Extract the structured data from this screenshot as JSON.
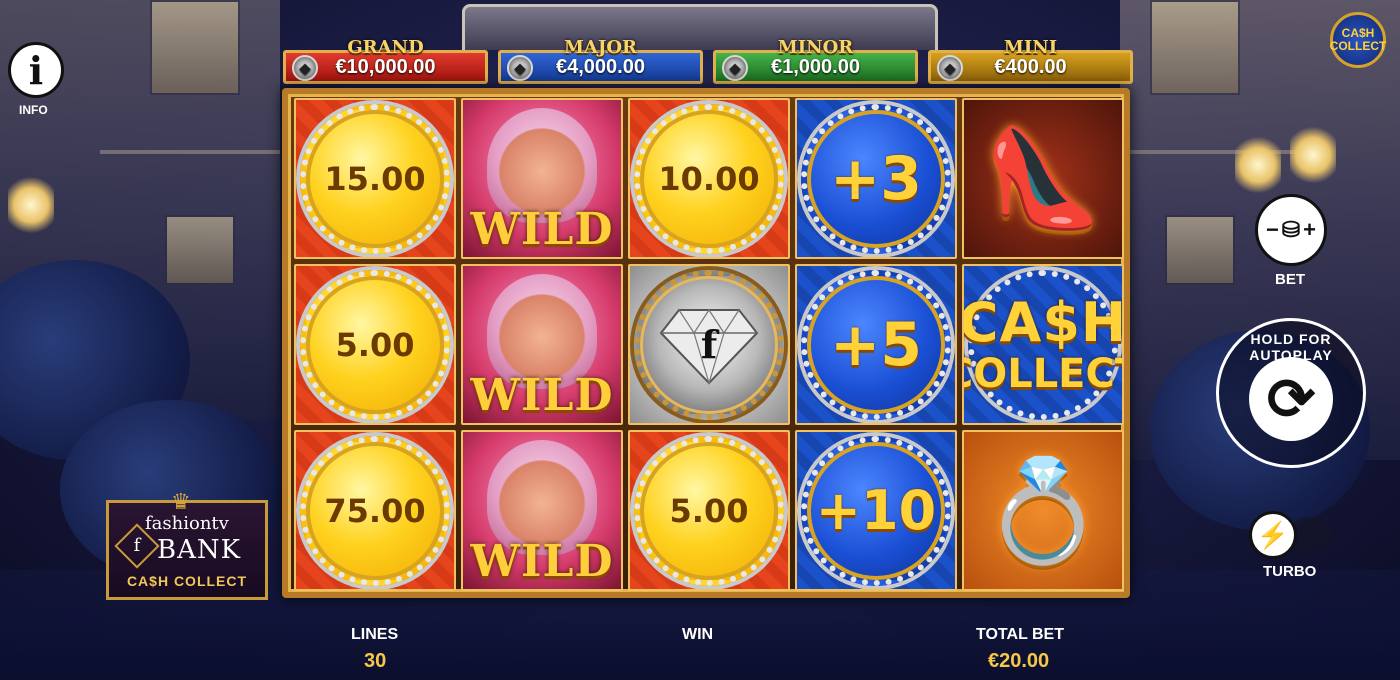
{
  "jackpots": {
    "grand": {
      "title": "GRAND",
      "amount": "€10,000.00"
    },
    "major": {
      "title": "MAJOR",
      "amount": "€4,000.00"
    },
    "minor": {
      "title": "MINOR",
      "amount": "€1,000.00"
    },
    "mini": {
      "title": "MINI",
      "amount": "€400.00"
    }
  },
  "reels": {
    "r1": {
      "c1": "15.00",
      "c2": "WILD",
      "c3": "10.00",
      "c4": "+3"
    },
    "r2": {
      "c1": "5.00",
      "c2": "WILD",
      "c3": "f",
      "c4": "+5",
      "c5a": "CA$H",
      "c5b": "COLLECT"
    },
    "r3": {
      "c1": "75.00",
      "c2": "WILD",
      "c3": "5.00",
      "c4": "+10"
    }
  },
  "left": {
    "info_label": "INFO",
    "logo": {
      "line1": "fashiontv",
      "mark": "f",
      "line2": "BANK",
      "line3": "CA$H COLLECT"
    }
  },
  "right": {
    "badge_line1": "CA$H",
    "badge_line2": "COLLECT",
    "bet_label": "BET",
    "autoplay_text": "HOLD FOR AUTOPLAY",
    "turbo_label": "TURBO"
  },
  "bottom": {
    "lines_label": "LINES",
    "lines_value": "30",
    "win_label": "WIN",
    "total_bet_label": "TOTAL BET",
    "total_bet_value": "€20.00"
  },
  "colors": {
    "grand": "#e23a2e",
    "major": "#2f66d8",
    "minor": "#45b34a",
    "mini": "#d6a01f",
    "gold_text": "#f5c84a"
  }
}
